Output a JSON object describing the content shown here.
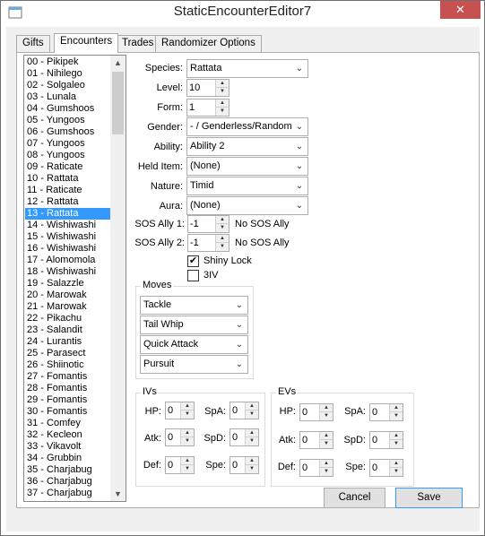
{
  "window": {
    "title": "StaticEncounterEditor7",
    "close_label": "✕"
  },
  "tabs": [
    "Gifts",
    "Encounters",
    "Trades",
    "Randomizer Options"
  ],
  "list": {
    "items": [
      "00 - Pikipek",
      "01 - Nihilego",
      "02 - Solgaleo",
      "03 - Lunala",
      "04 - Gumshoos",
      "05 - Yungoos",
      "06 - Gumshoos",
      "07 - Yungoos",
      "08 - Yungoos",
      "09 - Raticate",
      "10 - Rattata",
      "11 - Raticate",
      "12 - Rattata",
      "13 - Rattata",
      "14 - Wishiwashi",
      "15 - Wishiwashi",
      "16 - Wishiwashi",
      "17 - Alomomola",
      "18 - Wishiwashi",
      "19 - Salazzle",
      "20 - Marowak",
      "21 - Marowak",
      "22 - Pikachu",
      "23 - Salandit",
      "24 - Lurantis",
      "25 - Parasect",
      "26 - Shiinotic",
      "27 - Fomantis",
      "28 - Fomantis",
      "29 - Fomantis",
      "30 - Fomantis",
      "31 - Comfey",
      "32 - Kecleon",
      "33 - Vikavolt",
      "34 - Grubbin",
      "35 - Charjabug",
      "36 - Charjabug",
      "37 - Charjabug"
    ],
    "selected_index": 13
  },
  "form": {
    "species": {
      "label": "Species:",
      "value": "Rattata"
    },
    "level": {
      "label": "Level:",
      "value": "10"
    },
    "form_field": {
      "label": "Form:",
      "value": "1"
    },
    "gender": {
      "label": "Gender:",
      "value": "- / Genderless/Random"
    },
    "ability": {
      "label": "Ability:",
      "value": "Ability 2"
    },
    "held_item": {
      "label": "Held Item:",
      "value": "(None)"
    },
    "nature": {
      "label": "Nature:",
      "value": "Timid"
    },
    "aura": {
      "label": "Aura:",
      "value": "(None)"
    },
    "sos1": {
      "label": "SOS Ally 1:",
      "value": "-1",
      "note": "No SOS Ally"
    },
    "sos2": {
      "label": "SOS Ally 2:",
      "value": "-1",
      "note": "No SOS Ally"
    },
    "shiny_lock": {
      "label": "Shiny Lock",
      "checked": true
    },
    "three_iv": {
      "label": "3IV",
      "checked": false
    }
  },
  "moves": {
    "title": "Moves",
    "items": [
      "Tackle",
      "Tail Whip",
      "Quick Attack",
      "Pursuit"
    ]
  },
  "ivs": {
    "title": "IVs",
    "hp": {
      "label": "HP:",
      "value": "0"
    },
    "spa": {
      "label": "SpA:",
      "value": "0"
    },
    "atk": {
      "label": "Atk:",
      "value": "0"
    },
    "spd": {
      "label": "SpD:",
      "value": "0"
    },
    "def": {
      "label": "Def:",
      "value": "0"
    },
    "spe": {
      "label": "Spe:",
      "value": "0"
    }
  },
  "evs": {
    "title": "EVs",
    "hp": {
      "label": "HP:",
      "value": "0"
    },
    "spa": {
      "label": "SpA:",
      "value": "0"
    },
    "atk": {
      "label": "Atk:",
      "value": "0"
    },
    "spd": {
      "label": "SpD:",
      "value": "0"
    },
    "def": {
      "label": "Def:",
      "value": "0"
    },
    "spe": {
      "label": "Spe:",
      "value": "0"
    }
  },
  "buttons": {
    "cancel": "Cancel",
    "save": "Save"
  },
  "colors": {
    "selection": "#3399ff",
    "close": "#c75050"
  }
}
